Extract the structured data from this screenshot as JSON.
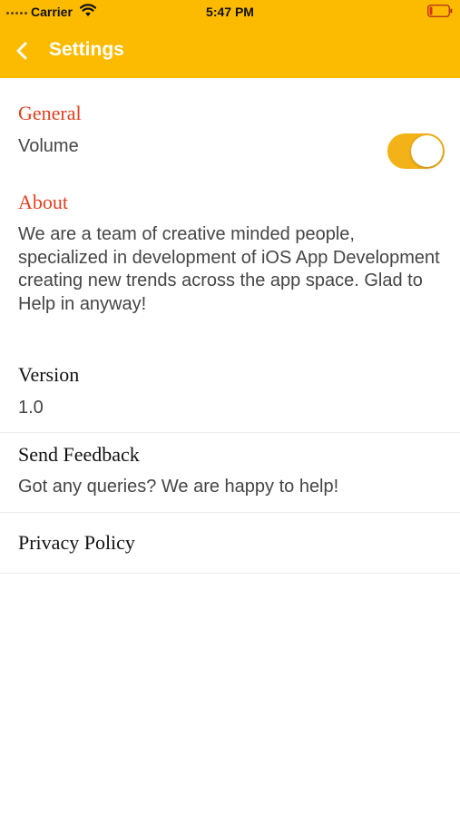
{
  "status_bar": {
    "carrier": "Carrier",
    "time": "5:47 PM",
    "wifi_icon": "wifi-icon",
    "battery_icon": "battery-low-icon"
  },
  "nav": {
    "back_icon": "chevron-left-icon",
    "title": "Settings"
  },
  "colors": {
    "accent": "#FDBB00",
    "section_title": "#E2401F",
    "toggle_on": "#F3B217"
  },
  "general": {
    "title": "General",
    "volume_label": "Volume",
    "volume_enabled": true
  },
  "about": {
    "title": "About",
    "text": "We are a team of creative minded people, specialized in development of iOS App Development creating new trends across the app space. Glad to Help in anyway!"
  },
  "version": {
    "title": "Version",
    "value": "1.0"
  },
  "feedback": {
    "title": "Send Feedback",
    "subtitle": "Got any queries? We are happy to help!"
  },
  "privacy": {
    "title": "Privacy Policy"
  }
}
